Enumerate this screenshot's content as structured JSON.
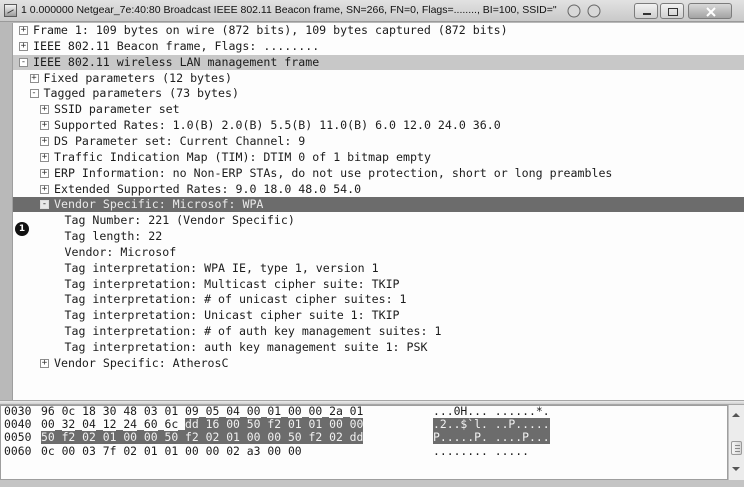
{
  "window": {
    "title": "1 0.000000 Netgear_7e:40:80 Broadcast IEEE 802.11 Beacon frame, SN=266, FN=0, Flags=........, BI=100, SSID=\""
  },
  "tree": [
    {
      "indent": 0,
      "expander": "+",
      "text": "Frame 1: 109 bytes on wire (872 bits), 109 bytes captured (872 bits)",
      "highlight": "none"
    },
    {
      "indent": 0,
      "expander": "+",
      "text": "IEEE 802.11 Beacon frame, Flags: ........",
      "highlight": "none"
    },
    {
      "indent": 0,
      "expander": "-",
      "text": "IEEE 802.11 wireless LAN management frame",
      "highlight": "gray"
    },
    {
      "indent": 1,
      "expander": "+",
      "text": "Fixed parameters (12 bytes)",
      "highlight": "none"
    },
    {
      "indent": 1,
      "expander": "-",
      "text": "Tagged parameters (73 bytes)",
      "highlight": "none"
    },
    {
      "indent": 2,
      "expander": "+",
      "text": "SSID parameter set",
      "highlight": "none"
    },
    {
      "indent": 2,
      "expander": "+",
      "text": "Supported Rates: 1.0(B) 2.0(B) 5.5(B) 11.0(B) 6.0 12.0 24.0 36.0",
      "highlight": "none"
    },
    {
      "indent": 2,
      "expander": "+",
      "text": "DS Parameter set: Current Channel: 9",
      "highlight": "none"
    },
    {
      "indent": 2,
      "expander": "+",
      "text": "Traffic Indication Map (TIM): DTIM 0 of 1 bitmap empty",
      "highlight": "none"
    },
    {
      "indent": 2,
      "expander": "+",
      "text": "ERP Information: no Non-ERP STAs, do not use protection, short or long preambles",
      "highlight": "none"
    },
    {
      "indent": 2,
      "expander": "+",
      "text": "Extended Supported Rates: 9.0 18.0 48.0 54.0",
      "highlight": "none"
    },
    {
      "indent": 2,
      "expander": "-",
      "text": "Vendor Specific: Microsof: WPA",
      "highlight": "dark"
    },
    {
      "indent": 3,
      "expander": "",
      "text": "Tag Number: 221 (Vendor Specific)",
      "highlight": "none"
    },
    {
      "indent": 3,
      "expander": "",
      "text": "Tag length: 22",
      "highlight": "none"
    },
    {
      "indent": 3,
      "expander": "",
      "text": "Vendor: Microsof",
      "highlight": "none"
    },
    {
      "indent": 3,
      "expander": "",
      "text": "Tag interpretation: WPA IE, type 1, version 1",
      "highlight": "none"
    },
    {
      "indent": 3,
      "expander": "",
      "text": "Tag interpretation: Multicast cipher suite: TKIP",
      "highlight": "none"
    },
    {
      "indent": 3,
      "expander": "",
      "text": "Tag interpretation: # of unicast cipher suites: 1",
      "highlight": "none"
    },
    {
      "indent": 3,
      "expander": "",
      "text": "Tag interpretation: Unicast cipher suite 1: TKIP",
      "highlight": "none"
    },
    {
      "indent": 3,
      "expander": "",
      "text": "Tag interpretation: # of auth key management suites: 1",
      "highlight": "none"
    },
    {
      "indent": 3,
      "expander": "",
      "text": "Tag interpretation: auth key management suite 1: PSK",
      "highlight": "none"
    },
    {
      "indent": 2,
      "expander": "+",
      "text": "Vendor Specific: AtherosC",
      "highlight": "none"
    }
  ],
  "annotation": {
    "badge": "1"
  },
  "hex": {
    "lines": [
      {
        "offset": "0030",
        "bytes": [
          "96",
          "0c",
          "18",
          "30",
          "48",
          "03",
          "01",
          "09",
          "05",
          "04",
          "00",
          "01",
          "00",
          "00",
          "2a",
          "01"
        ],
        "ascii": "...0H... ......*.",
        "selected_from": 16,
        "ascii_selected": ""
      },
      {
        "offset": "0040",
        "bytes": [
          "00",
          "32",
          "04",
          "12",
          "24",
          "60",
          "6c",
          "dd",
          "16",
          "00",
          "50",
          "f2",
          "01",
          "01",
          "00",
          "00"
        ],
        "ascii": ".2..$`l. ..P.....",
        "selected_from": 7,
        "ascii_selected": "yes"
      },
      {
        "offset": "0050",
        "bytes": [
          "50",
          "f2",
          "02",
          "01",
          "00",
          "00",
          "50",
          "f2",
          "02",
          "01",
          "00",
          "00",
          "50",
          "f2",
          "02",
          "dd"
        ],
        "ascii": "P.....P. ....P...",
        "selected_from": 0,
        "ascii_selected": "yes"
      },
      {
        "offset": "0060",
        "bytes": [
          "0c",
          "00",
          "03",
          "7f",
          "02",
          "01",
          "01",
          "00",
          "00",
          "02",
          "a3",
          "00",
          "00"
        ],
        "ascii": "........ .....",
        "selected_from": 99,
        "ascii_selected": ""
      }
    ]
  }
}
